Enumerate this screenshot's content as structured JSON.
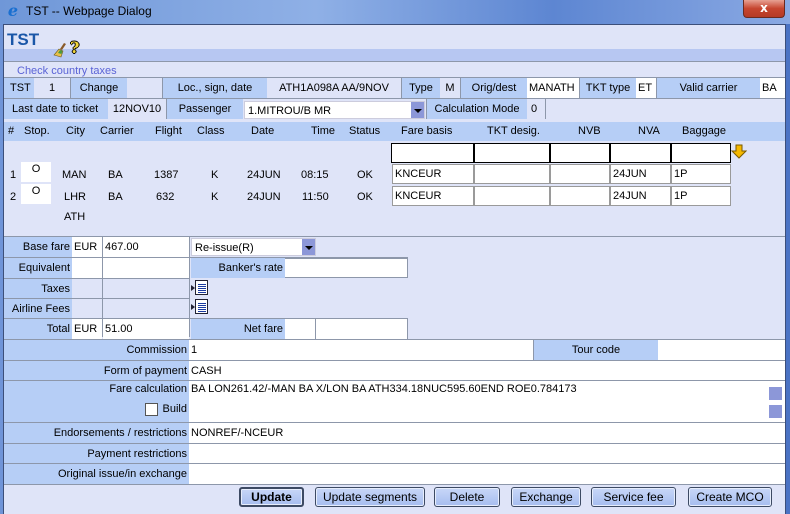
{
  "window": {
    "title": "TST -- Webpage Dialog",
    "close_glyph": "x"
  },
  "app": {
    "title": "TST",
    "icons": [
      "broom-icon",
      "help-icon"
    ],
    "help_glyph": "?",
    "check_taxes_link": "Check country taxes"
  },
  "header_row1": {
    "tst_label": "TST",
    "tst_value": "1",
    "change_label": "Change",
    "change_value": "",
    "loc_label": "Loc., sign, date",
    "loc_value": "ATH1A098A AA/9NOV",
    "type_label": "Type",
    "type_value": "M",
    "origdest_label": "Orig/dest",
    "origdest_value": "MANATH",
    "tkt_type_label": "TKT type",
    "tkt_type_value": "ET",
    "valid_carrier_label": "Valid carrier",
    "valid_carrier_value": "BA"
  },
  "header_row2": {
    "last_date_label": "Last date to ticket",
    "last_date_value": "12NOV10",
    "passenger_label": "Passenger",
    "passenger_value": "1.MITROU/B MR",
    "calc_mode_label": "Calculation Mode",
    "calc_mode_value": "0"
  },
  "columns": {
    "num": "#",
    "stop": "Stop.",
    "city": "City",
    "carrier": "Carrier",
    "flight": "Flight",
    "class": "Class",
    "date": "Date",
    "time": "Time",
    "status": "Status",
    "fare_basis": "Fare basis",
    "tkt_desig": "TKT desig.",
    "nvb": "NVB",
    "nva": "NVA",
    "baggage": "Baggage"
  },
  "segments": [
    {
      "num": "1",
      "stop": "O",
      "city": "MAN",
      "carrier": "BA",
      "flight": "1387",
      "class": "K",
      "date": "24JUN",
      "time": "08:15",
      "status": "OK",
      "fare_basis": "KNCEUR",
      "tkt_desig": "",
      "nvb": "",
      "nva": "24JUN",
      "baggage": "1P"
    },
    {
      "num": "2",
      "stop": "O",
      "city": "LHR",
      "carrier": "BA",
      "flight": "632",
      "class": "K",
      "date": "24JUN",
      "time": "11:50",
      "status": "OK",
      "fare_basis": "KNCEUR",
      "tkt_desig": "",
      "nvb": "",
      "nva": "24JUN",
      "baggage": "1P"
    }
  ],
  "final_city": "ATH",
  "fares": {
    "base_fare_label": "Base fare",
    "base_fare_currency": "EUR",
    "base_fare_amount": "467.00",
    "reissue_value": "Re-issue(R)",
    "equivalent_label": "Equivalent",
    "equivalent_currency": "",
    "equivalent_amount": "",
    "bankers_rate_label": "Banker's rate",
    "bankers_rate_value": "",
    "taxes_label": "Taxes",
    "airline_fees_label": "Airline Fees",
    "total_label": "Total",
    "total_currency": "EUR",
    "total_amount": "51.00",
    "net_fare_label": "Net fare",
    "net_fare_value": ""
  },
  "details": {
    "commission_label": "Commission",
    "commission_value": "1",
    "tour_code_label": "Tour code",
    "tour_code_value": "",
    "form_of_payment_label": "Form of payment",
    "form_of_payment_value": "CASH",
    "fare_calc_label": "Fare calculation",
    "fare_calc_value": "BA LON261.42/-MAN BA X/LON BA ATH334.18NUC595.60END ROE0.784173",
    "build_label": "Build",
    "build_checked": false,
    "endorsements_label": "Endorsements / restrictions",
    "endorsements_value": "NONREF/-NCEUR",
    "payment_restrictions_label": "Payment restrictions",
    "payment_restrictions_value": "",
    "original_issue_label": "Original issue/in exchange",
    "original_issue_value": ""
  },
  "buttons": {
    "update": "Update",
    "update_segments": "Update segments",
    "delete": "Delete",
    "exchange": "Exchange",
    "service_fee": "Service fee",
    "create_mco": "Create MCO"
  },
  "colors": {
    "label_bg": "#b6cef6",
    "panel_bg": "#dfe4f8",
    "title_blue": "#1b57a8",
    "link": "#5a63d6"
  }
}
